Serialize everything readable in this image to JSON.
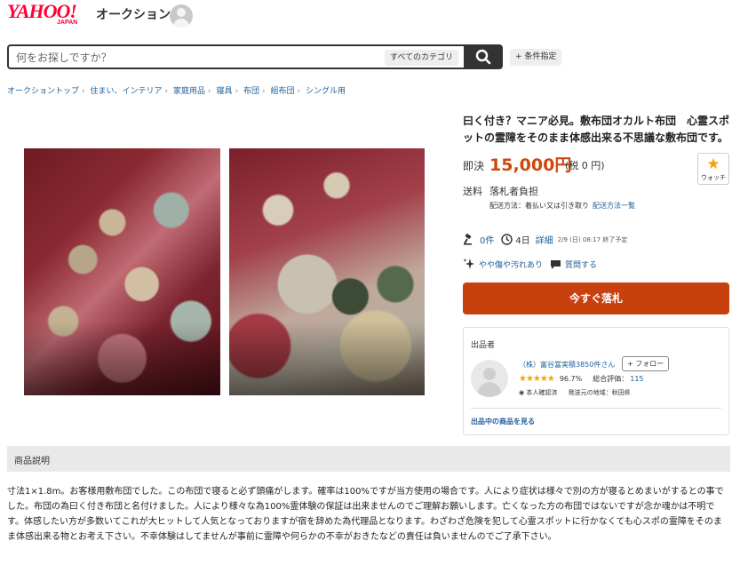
{
  "header": {
    "logo_text": "YAHOO!",
    "logo_sub": "JAPAN",
    "brand": "オークション"
  },
  "search": {
    "placeholder": "何をお探しですか？",
    "category": "すべてのカテゴリ",
    "conditions": "+ 条件指定"
  },
  "breadcrumb": [
    "オークショントップ",
    "住まい、インテリア",
    "家庭用品",
    "寝具",
    "布団",
    "組布団",
    "シングル用"
  ],
  "item": {
    "title": "曰く付き？マニア必見。敷布団オカルト布団　心霊スポットの霊障をそのまま体感出来る不思議な敷布団です。",
    "price_label": "即決",
    "price": "15,000円",
    "tax": "(税 0 円)",
    "watch_label": "ウォッチ",
    "shipping_label": "送料",
    "shipping_value": "落札者負担",
    "ship_method": "配送方法：着払い又は引き取り",
    "ship_link": "配送方法一覧",
    "bids": "0件",
    "time_left": "4日",
    "detail_link": "詳細",
    "end_time": "2/9 (日) 08:17 終了予定",
    "condition": "やや傷や汚れあり",
    "question_link": "質問する",
    "buy_now": "今すぐ落札"
  },
  "seller": {
    "heading": "出品者",
    "name": "（株）富谷當実積3850件さん",
    "follow": "+ フォロー",
    "rating_pct": "96.7%",
    "total_label": "総合評価：",
    "total_value": "115",
    "verified": "本人確認済",
    "location": "発送元の地域：秋田県",
    "items_link": "出品中の商品を見る"
  },
  "description": {
    "title": "商品説明",
    "body": "寸法1×1.8m。お客様用敷布団でした。この布団で寝ると必ず頭痛がします。確率は100%ですが当方使用の場合です。人により症状は様々で別の方が寝るとめまいがするとの事でした。布団の為曰く付き布団と名付けました。人により様々な為100%霊体験の保証は出来ませんのでご理解お願いします。亡くなった方の布団ではないですが念か魂かは不明です。体感したい方が多数いてこれが大ヒットして人気となっておりますが宿を辞めた為代理品となります。わざわざ危険を犯して心霊スポットに行かなくても心スポの霊障をそのまま体感出来る物とお考え下さい。不幸体験はしてませんが事前に霊障や何らかの不幸がおきたなどの責任は負いませんのでご了承下さい。"
  },
  "colors": {
    "price": "#d0470c",
    "buy_button": "#c8400d",
    "link": "#1e5f99",
    "logo": "#ff0033"
  }
}
